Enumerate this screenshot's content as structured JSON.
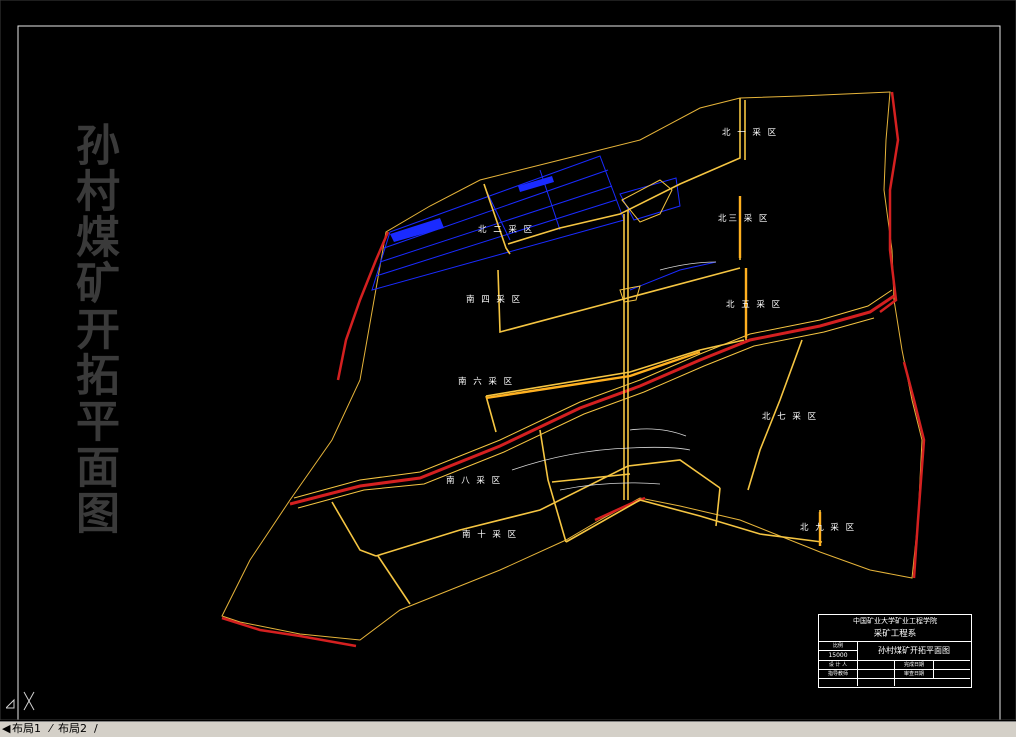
{
  "drawing": {
    "vertical_title": "孙村煤矿开拓平面图",
    "zones": [
      {
        "key": "north1",
        "label": "北 一 采 区"
      },
      {
        "key": "north2",
        "label": "北 二 采 区"
      },
      {
        "key": "north3",
        "label": "北三 采 区"
      },
      {
        "key": "south4",
        "label": "南 四 采 区"
      },
      {
        "key": "north5",
        "label": "北 五 采 区"
      },
      {
        "key": "south6",
        "label": "南 六 采 区"
      },
      {
        "key": "north7",
        "label": "北 七 采 区"
      },
      {
        "key": "south8",
        "label": "南 八 采 区"
      },
      {
        "key": "north9",
        "label": "北 九 采 区"
      },
      {
        "key": "south10",
        "label": "南 十 采 区"
      }
    ]
  },
  "title_block": {
    "school": "中国矿业大学矿业工程学院",
    "dept": "采矿工程系",
    "scale_label": "比例",
    "scale": "15000",
    "drawing_name": "孙村煤矿开拓平面图",
    "designer_label": "设 计 人",
    "date_label": "完成日期",
    "teacher_label": "指导教师",
    "review_label": "审查日期"
  },
  "tabs": {
    "layout1": "布局1",
    "layout2": "布局2"
  },
  "colors": {
    "background": "#000000",
    "roadway": "#f5c542",
    "boundary_red": "#d42020",
    "goaf_blue": "#1a2bff",
    "title_gray": "#3a3a3a"
  }
}
